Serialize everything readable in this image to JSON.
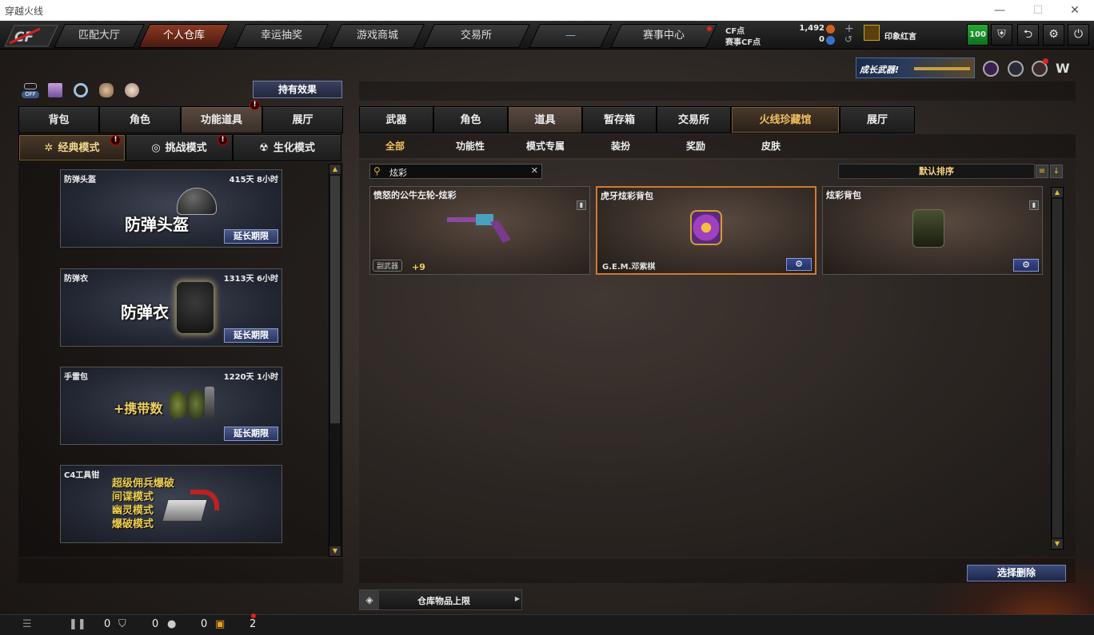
{
  "window": {
    "title": "穿越火线"
  },
  "nav": {
    "tabs": [
      "匹配大厅",
      "个人仓库",
      "幸运抽奖",
      "游戏商城",
      "交易所"
    ],
    "active": "个人仓库",
    "dash": "—",
    "event": "赛事中心"
  },
  "currency": {
    "cf_label": "CF点",
    "cf_value": "1,492",
    "event_label": "赛事CF点",
    "event_value": "0",
    "plus": "+",
    "refresh": "↺"
  },
  "user": {
    "name": "印象红言",
    "level": "100"
  },
  "toolbar_icons": [
    "shield-icon",
    "switch-icon",
    "gear-icon",
    "power-icon"
  ],
  "left": {
    "effects_button": "持有效果",
    "off_badge": "OFF",
    "category_tabs": [
      "背包",
      "角色",
      "功能道具",
      "展厅"
    ],
    "category_active": "功能道具",
    "mode_tabs": [
      "经典模式",
      "挑战模式",
      "生化模式"
    ],
    "mode_active": "经典模式",
    "items": [
      {
        "name": "防弹头盔",
        "time": "415天 8小时",
        "big": "防弹头盔",
        "extend": "延长期限"
      },
      {
        "name": "防弹衣",
        "time": "1313天 6小时",
        "big": "防弹衣",
        "extend": "延长期限"
      },
      {
        "name": "手雷包",
        "time": "1220天 1小时",
        "big": "+携带数",
        "extend": "延长期限"
      },
      {
        "name": "C4工具钳",
        "time": "",
        "lines": [
          "超级佣兵爆破",
          "间谍模式",
          "幽灵模式",
          "爆破模式"
        ]
      }
    ]
  },
  "right": {
    "banner_text": "成长武器!",
    "main_tabs": [
      "武器",
      "角色",
      "道具",
      "暂存箱",
      "交易所",
      "火线珍藏馆",
      "展厅"
    ],
    "main_active": "道具",
    "sub_tabs": [
      "全部",
      "功能性",
      "模式专属",
      "装扮",
      "奖励",
      "皮肤"
    ],
    "sub_active": "全部",
    "search_value": "炫彩",
    "search_clear": "✕",
    "sort_label": "默认排序",
    "items": [
      {
        "name": "愤怒的公牛左轮-炫彩",
        "tag": "副武器",
        "bonus": "+9"
      },
      {
        "name": "虎牙炫彩背包",
        "owner": "G.E.M.邓紫棋"
      },
      {
        "name": "炫彩背包"
      }
    ],
    "delete_button": "选择删除",
    "storage_limit": "仓库物品上限"
  },
  "bottom": {
    "c1": "0",
    "c2": "0",
    "c3": "0",
    "c4": "2"
  },
  "colors": {
    "accent_gold": "#f0c060",
    "active_tab": "#8a3a22",
    "level_green": "#1a9a2a"
  }
}
